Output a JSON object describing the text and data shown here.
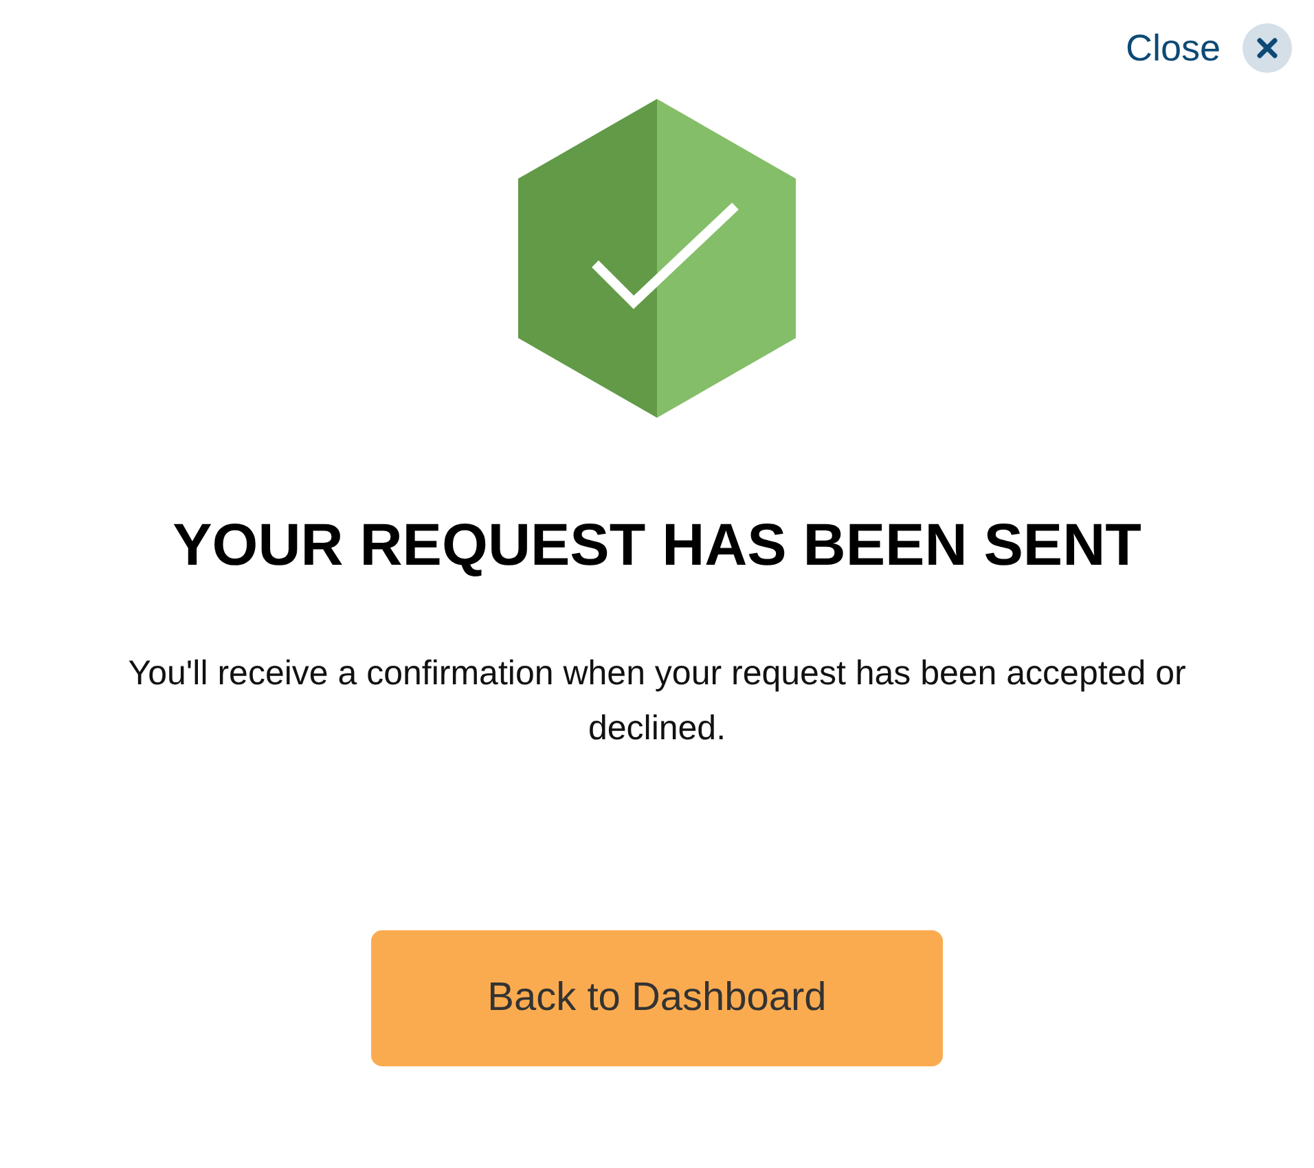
{
  "close": {
    "label": "Close"
  },
  "title": "YOUR REQUEST HAS BEEN SENT",
  "message": "You'll receive a confirmation when your request has been accepted or declined.",
  "button": {
    "label": "Back to Dashboard"
  }
}
